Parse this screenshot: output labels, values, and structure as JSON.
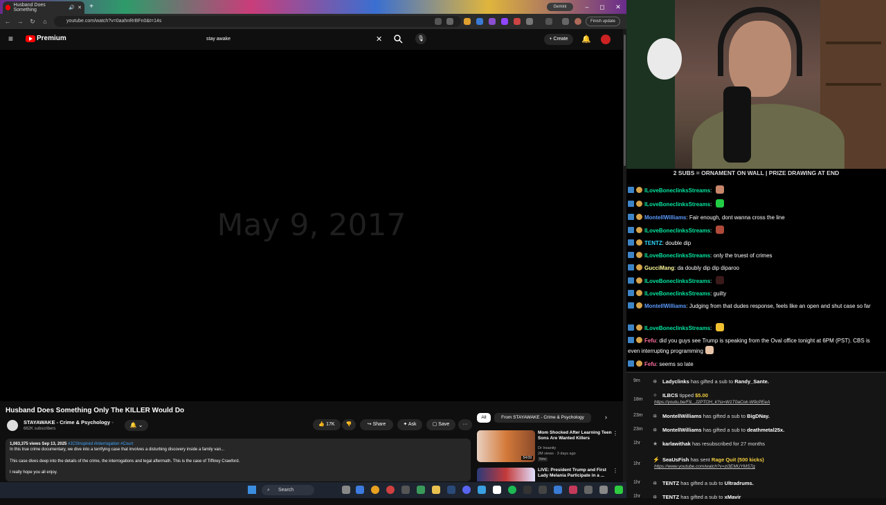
{
  "browser": {
    "tab_title": "Husband Does Something",
    "new_tab": "+",
    "gemini_label": "Gemini",
    "url": "youtube.com/watch?v=0aahnRrBFn0&t=14s",
    "finish_update": "Finish update",
    "window_controls": [
      "–",
      "◻",
      "✕"
    ]
  },
  "youtube": {
    "logo_text": "Premium",
    "search_value": "stay awake",
    "create_label": "Create",
    "video_overlay_text": "May 9, 2017",
    "title": "Husband Does Something Only The KILLER Would Do",
    "channel": "STAYAWAKE - Crime & Psychology",
    "verified_icon": "◦",
    "subscribers": "662K subscribers",
    "likes": "17K",
    "share_label": "Share",
    "ask_label": "Ask",
    "save_label": "Save",
    "more_label": "···",
    "description": {
      "meta": "1,063,375 views  Sep 13, 2025",
      "tags": "#JCSInspired #interrogation #Court",
      "line1": "In this true crime documentary, we dive into a terrifying case that involves a disturbing discovery inside a family van...",
      "line2": "This case dives deep into the details of the crime, the interrogations and legal aftermath. This is the case of Tiffiney Crawford.",
      "line3": "I really hope you all enjoy."
    },
    "chips": [
      "All",
      "From STAYAWAKE - Crime & Psychology"
    ],
    "recommendations": [
      {
        "title": "Mom Shocked After Learning Teen Sons Are Wanted Killers",
        "channel": "Dr Insanity",
        "meta": "2M views · 3 days ago",
        "duration": "54:09",
        "badge": "New"
      },
      {
        "title": "LIVE: President Trump and First Lady Melania Participate in a ...",
        "channel": "",
        "meta": "",
        "duration": "",
        "badge": ""
      }
    ]
  },
  "stream": {
    "banner": "2 SUBS = ORNAMENT ON WALL | PRIZE DRAWING AT END",
    "chat": [
      {
        "user": "ILoveBoneclinksStreams",
        "color": "#00e6a0",
        "text": "",
        "emote": "#c8876b"
      },
      {
        "user": "ILoveBoneclinksStreams",
        "color": "#00e6a0",
        "text": "",
        "emote": "#22cc44"
      },
      {
        "user": "MontellWilliams",
        "color": "#5c9cff",
        "text": "Fair enough, dont wanna cross the line",
        "emote": ""
      },
      {
        "user": "ILoveBoneclinksStreams",
        "color": "#00e6a0",
        "text": "",
        "emote": "#b04a3a"
      },
      {
        "user": "TENTZ",
        "color": "#33d9ff",
        "text": "double dip",
        "emote": ""
      },
      {
        "user": "ILoveBoneclinksStreams",
        "color": "#00e6a0",
        "text": "only the truest of crimes",
        "emote": ""
      },
      {
        "user": "GucciMang",
        "color": "#fffc9b",
        "text": "da doubly dip dip diparoo",
        "emote": ""
      },
      {
        "user": "ILoveBoneclinksStreams",
        "color": "#00e6a0",
        "text": "",
        "emote": "#3a1a1a"
      },
      {
        "user": "ILoveBoneclinksStreams",
        "color": "#00e6a0",
        "text": "guilty",
        "emote": ""
      },
      {
        "user": "MontellWilliams",
        "color": "#5c9cff",
        "text": "Judging from that dudes response, feels like an open and shut case so far",
        "emote": ""
      },
      {
        "user": "ILoveBoneclinksStreams",
        "color": "#00e6a0",
        "text": "",
        "emote": "#f0c030"
      },
      {
        "user": "Fefu",
        "color": "#ff6fa0",
        "text": "did you guys see Trump is speaking from the Oval office tonight at 6PM (PST). CBS is even interrupting programming",
        "emote": "#e8c4a8"
      },
      {
        "user": "Fefu",
        "color": "#ff6fa0",
        "text": "seems so late",
        "emote": ""
      }
    ],
    "events": [
      {
        "time": "9m",
        "icon": "gift-icon",
        "user": "Ladyclinks",
        "action": "has gifted a sub to",
        "target": "Randy_Sante.",
        "link": ""
      },
      {
        "time": "18m",
        "icon": "coin-icon",
        "user": "ILBCS",
        "action": "tipped",
        "target": "$5.00",
        "link": "https://youtu.be/FIL_J2PTOH_k?si=W1T0aCok-W9cPEeA"
      },
      {
        "time": "23m",
        "icon": "gift-icon",
        "user": "MontellWilliams",
        "action": "has gifted a sub to",
        "target": "BigDNay.",
        "link": ""
      },
      {
        "time": "23m",
        "icon": "gift-icon",
        "user": "MontellWilliams",
        "action": "has gifted a sub to",
        "target": "deathmetal25x.",
        "link": ""
      },
      {
        "time": "1hr",
        "icon": "star-icon",
        "user": "karlawithak",
        "action": "has resubscribed for 27 months",
        "target": "",
        "link": ""
      },
      {
        "time": "1hr",
        "icon": "bolt-icon",
        "user": "SeaUsFish",
        "action": "has sent",
        "target": "Rage Quit (500 kicks)",
        "link": "https://www.youtube.com/watch?v=zi3EMUYMS7g"
      },
      {
        "time": "1hr",
        "icon": "gift-icon",
        "user": "TENTZ",
        "action": "has gifted a sub to",
        "target": "Ultradrums.",
        "link": ""
      },
      {
        "time": "1hr",
        "icon": "gift-icon",
        "user": "TENTZ",
        "action": "has gifted a sub to",
        "target": "xMavir",
        "link": ""
      }
    ]
  },
  "taskbar": {
    "search_label": "Search"
  }
}
